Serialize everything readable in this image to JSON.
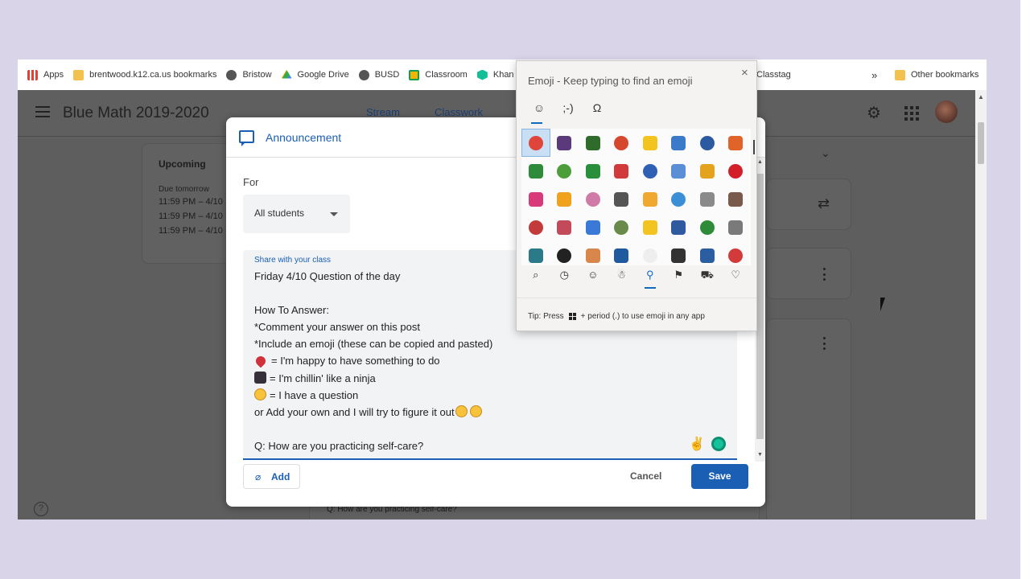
{
  "bookmarks": {
    "items": [
      {
        "label": "Apps",
        "icon": "apps-grid-icon",
        "color": "#db4437"
      },
      {
        "label": "brentwood.k12.ca.us bookmarks",
        "icon": "folder-icon",
        "color": "#f2c14e"
      },
      {
        "label": "Bristow",
        "icon": "globe-icon",
        "color": "#555555"
      },
      {
        "label": "Google Drive",
        "icon": "drive-icon",
        "color": "#34a853"
      },
      {
        "label": "BUSD",
        "icon": "globe-icon",
        "color": "#555555"
      },
      {
        "label": "Classroom",
        "icon": "classroom-icon",
        "color": "#f4b400"
      },
      {
        "label": "Khan",
        "icon": "khan-icon",
        "color": "#14bf96"
      }
    ],
    "classtag": "Classtag",
    "more": "»",
    "other": "Other bookmarks"
  },
  "classroom": {
    "title": "Blue Math 2019-2020",
    "tabs": [
      "Stream",
      "Classwork"
    ],
    "upcoming": {
      "title": "Upcoming",
      "due": "Due tomorrow",
      "items": [
        "11:59 PM – 4/10",
        "11:59 PM – 4/10",
        "11:59 PM – 4/10"
      ]
    },
    "bottom_question": "Q: How are you practicing self-care?"
  },
  "dialog": {
    "title": "Announcement",
    "for_label": "For",
    "audience": "All students",
    "body_label": "Share with your class",
    "lines": [
      "Friday 4/10 Question of the day",
      "",
      "How To Answer:",
      "*Comment your answer on this post",
      "*Include an emoji (these can be copied and pasted)",
      "= I'm happy to have something to do",
      "= I'm chillin' like a ninja",
      "= I have a question",
      "or Add your own and I will try to figure it out",
      "",
      "Q: How are you practicing self-care?"
    ],
    "add_label": "Add",
    "cancel_label": "Cancel",
    "save_label": "Save"
  },
  "emoji_panel": {
    "title": "Emoji - Keep typing to find an emoji",
    "close": "×",
    "tabs": [
      "☺",
      ";-)",
      "Ω"
    ],
    "grid_colors": [
      "#e0453a",
      "#5a3a7a",
      "#2f6b2a",
      "#d5482e",
      "#f3c320",
      "#3a7ac9",
      "#2c5aa0",
      "#e0642a",
      "#2e8b3a",
      "#4b9e3a",
      "#2a8f3a",
      "#d13a3a",
      "#3060b5",
      "#5a8fd6",
      "#e5a21c",
      "#d21f2a",
      "#d83a7a",
      "#f0a21c",
      "#d07aa8",
      "#555555",
      "#f0a830",
      "#3a8fd6",
      "#8a8a8a",
      "#7a5a4a",
      "#c23a3a",
      "#c24a5a",
      "#3a7ad6",
      "#6a8a4a",
      "#f3c320",
      "#2f5aa0",
      "#2e8b3a",
      "#7a7a7a",
      "#2a7a8a",
      "#222222",
      "#d9864a",
      "#1f5a9e",
      "#eeeeee",
      "#333333",
      "#2a5ea0",
      "#d33a3a"
    ],
    "categories": [
      "⌕",
      "◷",
      "☺",
      "☃",
      "⚲",
      "⚑",
      "⛟",
      "♡"
    ],
    "active_category": 4,
    "tip_prefix": "Tip: Press",
    "tip_suffix": "+ period (.) to use emoji in any app"
  }
}
